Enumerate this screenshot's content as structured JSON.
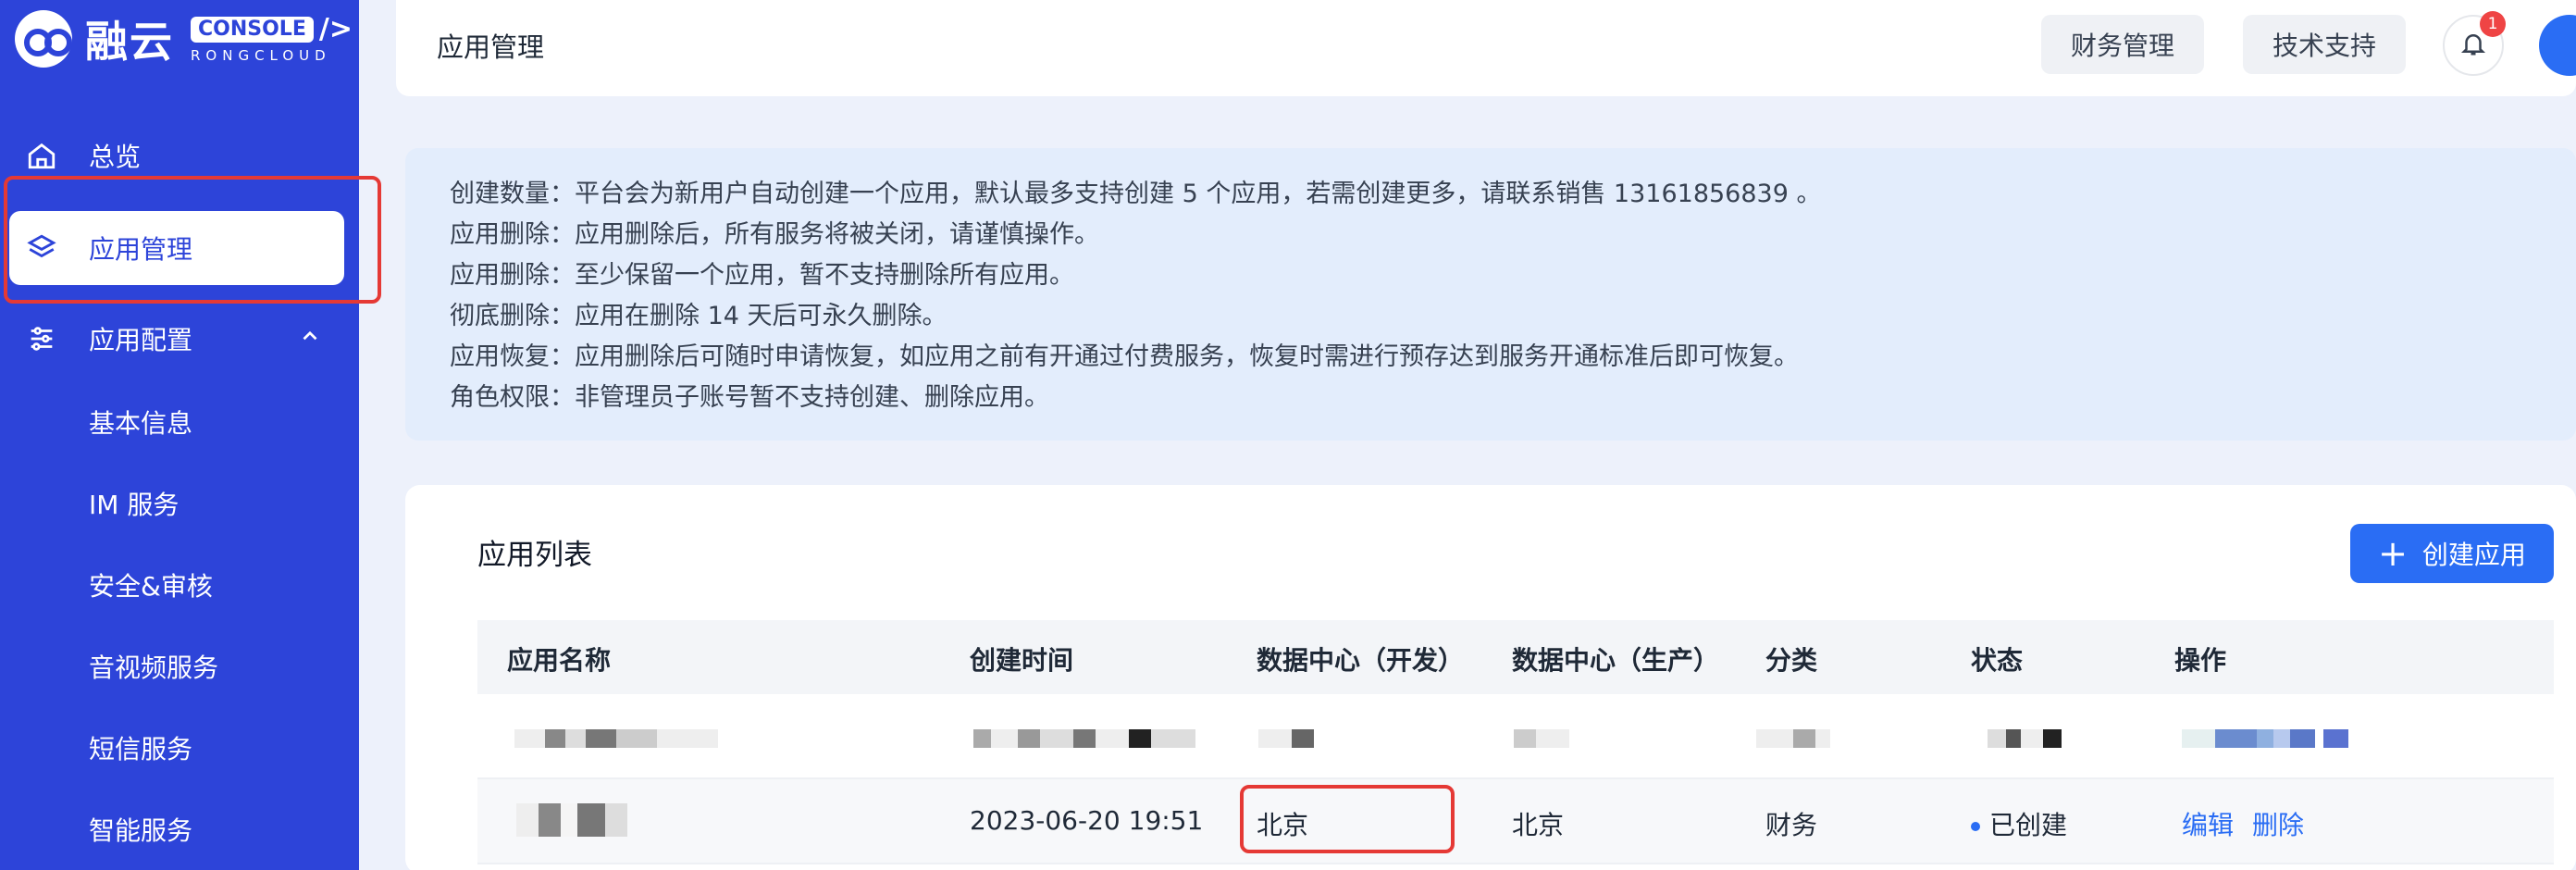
{
  "brand": {
    "name": "融云",
    "console": "CONSOLE",
    "sub": "RONGCLOUD"
  },
  "sidebar": {
    "items": [
      {
        "label": "总览"
      },
      {
        "label": "应用管理"
      },
      {
        "label": "应用配置"
      }
    ],
    "sub_items": [
      "基本信息",
      "IM 服务",
      "安全&审核",
      "音视频服务",
      "短信服务",
      "智能服务"
    ]
  },
  "header": {
    "title": "应用管理",
    "finance": "财务管理",
    "support": "技术支持",
    "notification_count": "1"
  },
  "notice": [
    "创建数量：平台会为新用户自动创建一个应用，默认最多支持创建 5 个应用，若需创建更多，请联系销售 13161856839 。",
    "应用删除：应用删除后，所有服务将被关闭，请谨慎操作。",
    "应用删除：至少保留一个应用，暂不支持删除所有应用。",
    "彻底删除：应用在删除 14 天后可永久删除。",
    "应用恢复：应用删除后可随时申请恢复，如应用之前有开通过付费服务，恢复时需进行预存达到服务开通标准后即可恢复。",
    "角色权限：非管理员子账号暂不支持创建、删除应用。"
  ],
  "app_list": {
    "title": "应用列表",
    "create_label": "创建应用",
    "columns": [
      "应用名称",
      "创建时间",
      "数据中心（开发）",
      "数据中心（生产）",
      "分类",
      "状态",
      "操作"
    ],
    "rows": [
      {
        "created": "2023-06-20 19:51",
        "dc_dev": "北京",
        "dc_prod": "北京",
        "category": "财务",
        "status": "已创建",
        "edit": "编辑",
        "delete": "删除"
      }
    ]
  }
}
